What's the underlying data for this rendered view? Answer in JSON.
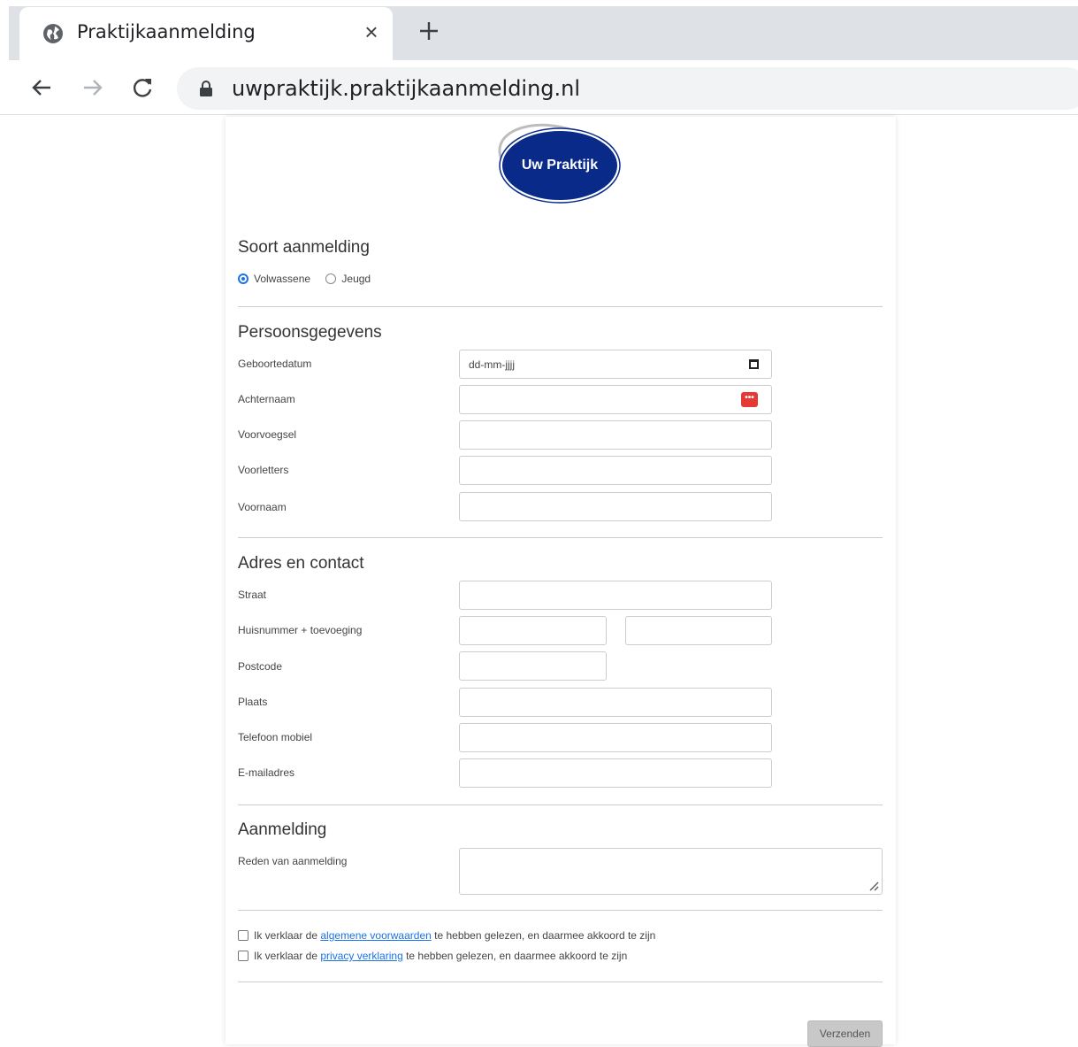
{
  "browser": {
    "tab_title": "Praktijkaanmelding",
    "close_tab": "×",
    "url": "uwpraktijk.praktijkaanmelding.nl"
  },
  "logo": {
    "text": "Uw Praktijk",
    "color": "#0a2a8a"
  },
  "sections": {
    "soort": "Soort aanmelding",
    "persoons": "Persoonsgegevens",
    "adres": "Adres en contact",
    "aanmelding": "Aanmelding"
  },
  "radios": {
    "volwassene": "Volwassene",
    "jeugd": "Jeugd",
    "selected": "Volwassene"
  },
  "labels": {
    "geboortedatum": "Geboortedatum",
    "achternaam": "Achternaam",
    "voorvoegsel": "Voorvoegsel",
    "voorletters": "Voorletters",
    "voornaam": "Voornaam",
    "straat": "Straat",
    "huisnummer": "Huisnummer + toevoeging",
    "postcode": "Postcode",
    "plaats": "Plaats",
    "telefoon": "Telefoon mobiel",
    "email": "E-mailadres",
    "reden": "Reden van aanmelding"
  },
  "fields": {
    "date_placeholder": "dd-mm-jjjj"
  },
  "checks": {
    "voorwaarden_prefix": "Ik verklaar de ",
    "voorwaarden_link": "algemene voorwaarden",
    "voorwaarden_suffix": " te hebben gelezen, en daarmee akkoord te zijn",
    "privacy_prefix": "Ik verklaar de ",
    "privacy_link": "privacy verklaring",
    "privacy_suffix": " te hebben gelezen, en daarmee akkoord te zijn"
  },
  "submit_label": "Verzenden",
  "colors": {
    "accent": "#1a73e8",
    "error_icon": "#e53935"
  }
}
